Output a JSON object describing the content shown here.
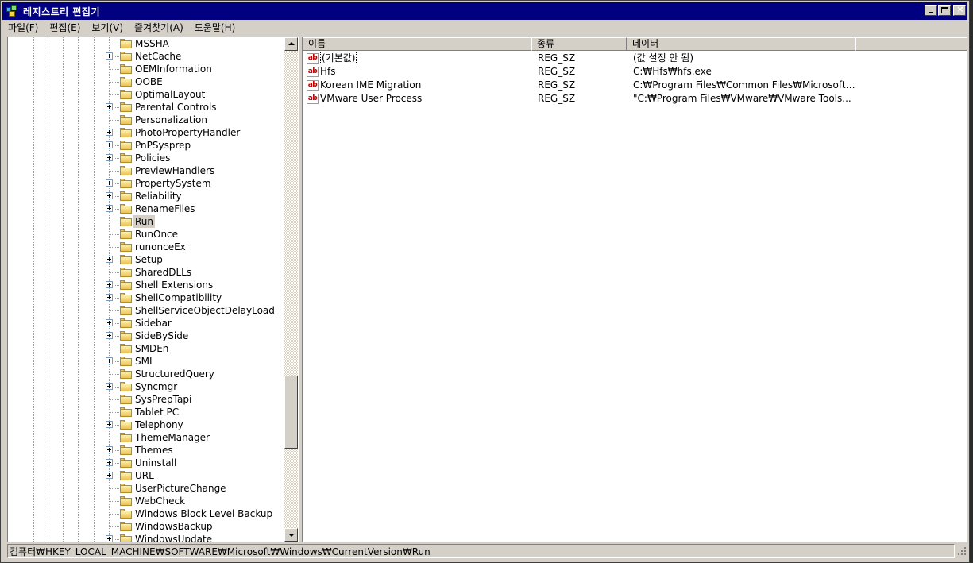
{
  "window": {
    "title": "레지스트리 편집기",
    "icon": "regedit-icon",
    "minimize": "minimize-icon",
    "maximize": "maximize-icon",
    "close": "close-icon",
    "close_glyph": "×"
  },
  "menu": {
    "items": [
      "파일(F)",
      "편집(E)",
      "보기(V)",
      "즐겨찾기(A)",
      "도움말(H)"
    ]
  },
  "tree": {
    "items": [
      {
        "label": "MSSHA",
        "expandable": false
      },
      {
        "label": "NetCache",
        "expandable": true
      },
      {
        "label": "OEMInformation",
        "expandable": false
      },
      {
        "label": "OOBE",
        "expandable": false
      },
      {
        "label": "OptimalLayout",
        "expandable": false
      },
      {
        "label": "Parental Controls",
        "expandable": true
      },
      {
        "label": "Personalization",
        "expandable": false
      },
      {
        "label": "PhotoPropertyHandler",
        "expandable": true
      },
      {
        "label": "PnPSysprep",
        "expandable": true
      },
      {
        "label": "Policies",
        "expandable": true
      },
      {
        "label": "PreviewHandlers",
        "expandable": false
      },
      {
        "label": "PropertySystem",
        "expandable": true
      },
      {
        "label": "Reliability",
        "expandable": true
      },
      {
        "label": "RenameFiles",
        "expandable": true
      },
      {
        "label": "Run",
        "expandable": false,
        "selected": true
      },
      {
        "label": "RunOnce",
        "expandable": false
      },
      {
        "label": "runonceEx",
        "expandable": false
      },
      {
        "label": "Setup",
        "expandable": true
      },
      {
        "label": "SharedDLLs",
        "expandable": false
      },
      {
        "label": "Shell Extensions",
        "expandable": true
      },
      {
        "label": "ShellCompatibility",
        "expandable": true
      },
      {
        "label": "ShellServiceObjectDelayLoad",
        "expandable": false
      },
      {
        "label": "Sidebar",
        "expandable": true
      },
      {
        "label": "SideBySide",
        "expandable": true
      },
      {
        "label": "SMDEn",
        "expandable": false
      },
      {
        "label": "SMI",
        "expandable": true
      },
      {
        "label": "StructuredQuery",
        "expandable": false
      },
      {
        "label": "Syncmgr",
        "expandable": true
      },
      {
        "label": "SysPrepTapi",
        "expandable": false
      },
      {
        "label": "Tablet PC",
        "expandable": false
      },
      {
        "label": "Telephony",
        "expandable": true
      },
      {
        "label": "ThemeManager",
        "expandable": false
      },
      {
        "label": "Themes",
        "expandable": true
      },
      {
        "label": "Uninstall",
        "expandable": true
      },
      {
        "label": "URL",
        "expandable": true
      },
      {
        "label": "UserPictureChange",
        "expandable": false
      },
      {
        "label": "WebCheck",
        "expandable": false
      },
      {
        "label": "Windows Block Level Backup",
        "expandable": false
      },
      {
        "label": "WindowsBackup",
        "expandable": false
      },
      {
        "label": "WindowsUpdate",
        "expandable": true
      }
    ]
  },
  "list": {
    "columns": [
      "이름",
      "종류",
      "데이터"
    ],
    "rows": [
      {
        "name": "(기본값)",
        "type": "REG_SZ",
        "data": "(값 설정 안 됨)",
        "boxed": true
      },
      {
        "name": "Hfs",
        "type": "REG_SZ",
        "data": "C:₩Hfs₩hfs.exe"
      },
      {
        "name": "Korean IME Migration",
        "type": "REG_SZ",
        "data": "C:₩Program Files₩Common Files₩Microsoft ..."
      },
      {
        "name": "VMware User Process",
        "type": "REG_SZ",
        "data": "\"C:₩Program Files₩VMware₩VMware Tools..."
      }
    ],
    "value_icon_text": "ab"
  },
  "status": {
    "path": "컴퓨터₩HKEY_LOCAL_MACHINE₩SOFTWARE₩Microsoft₩Windows₩CurrentVersion₩Run"
  }
}
